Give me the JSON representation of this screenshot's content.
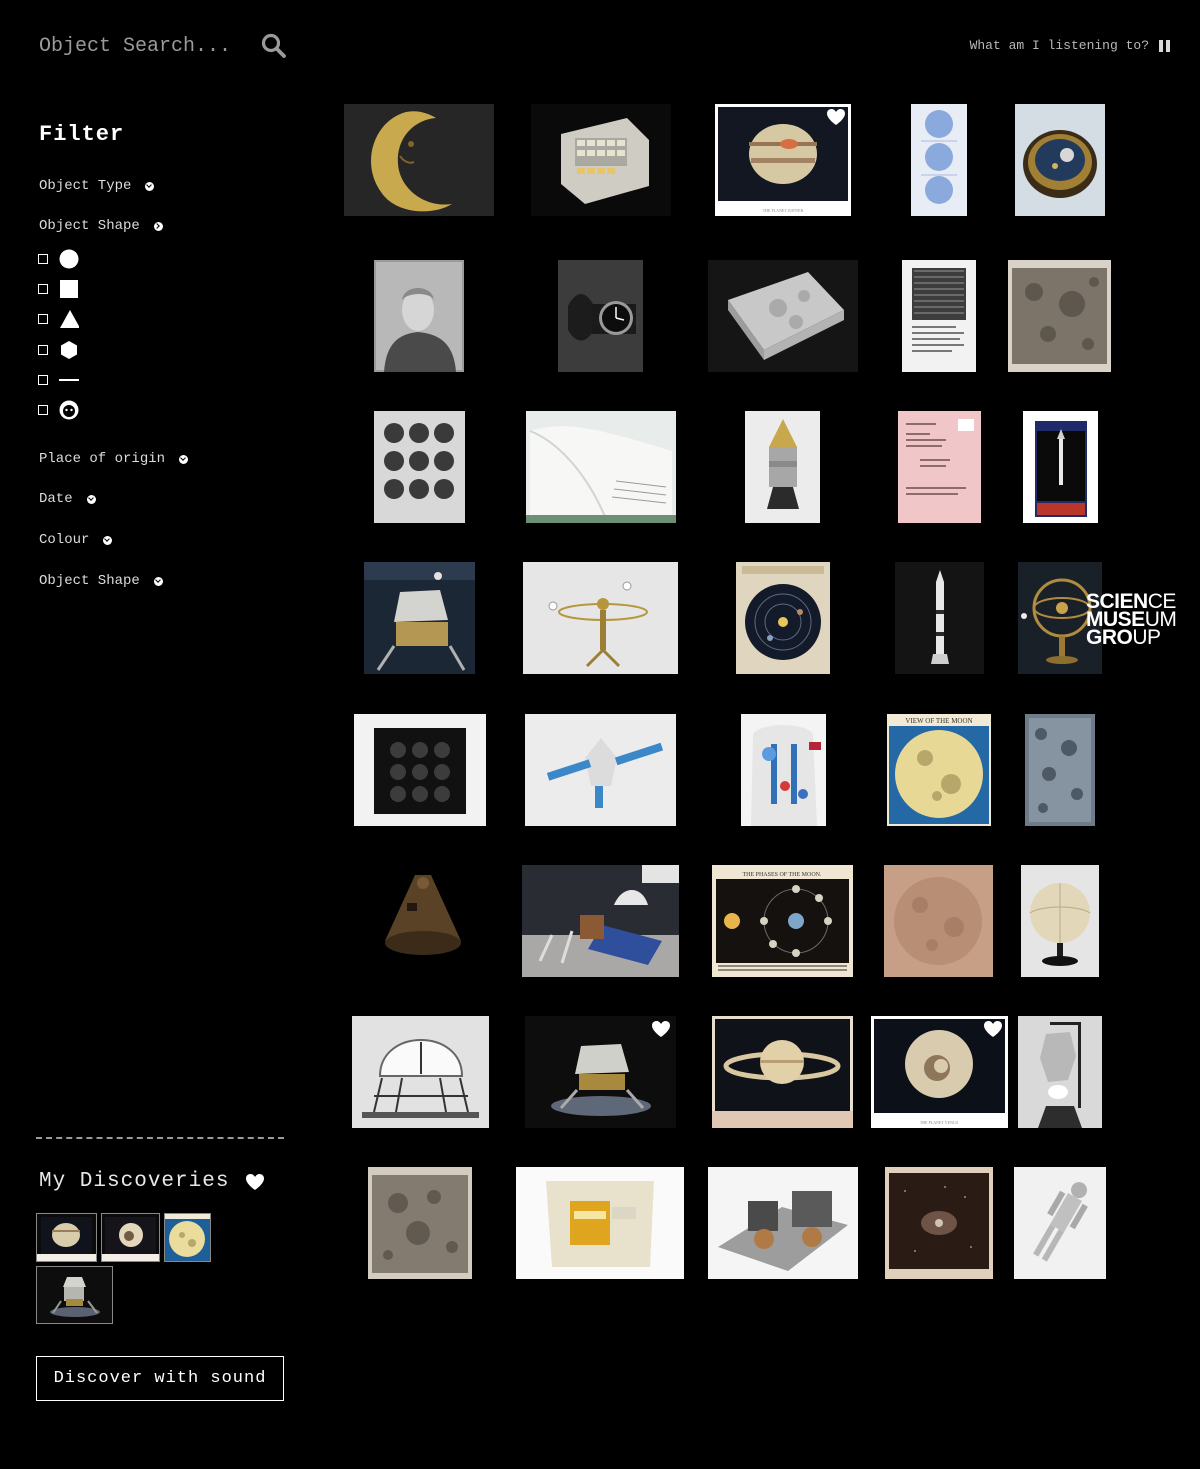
{
  "search": {
    "placeholder": "Object Search..."
  },
  "header": {
    "listening_label": "What am I listening to?"
  },
  "filter": {
    "title": "Filter",
    "groups": [
      "Object Type",
      "Object Shape",
      "Place of origin",
      "Date",
      "Colour",
      "Object Shape"
    ],
    "shapes": [
      "circle-shape",
      "square-shape",
      "triangle-shape",
      "hexagon-shape",
      "line-shape",
      "face-shape"
    ]
  },
  "discoveries": {
    "title": "My Discoveries"
  },
  "sound_button": {
    "label": "Discover with sound"
  },
  "logo": {
    "line1_bold": "SCIEN",
    "line1_rest": "CE",
    "line2_bold": "MUSE",
    "line2_rest": "UM",
    "line3_bold": "GRO",
    "line3_rest": "UP"
  },
  "colors": {
    "background": "#000000",
    "text": "#ffffff",
    "muted": "#9a9a9a"
  }
}
